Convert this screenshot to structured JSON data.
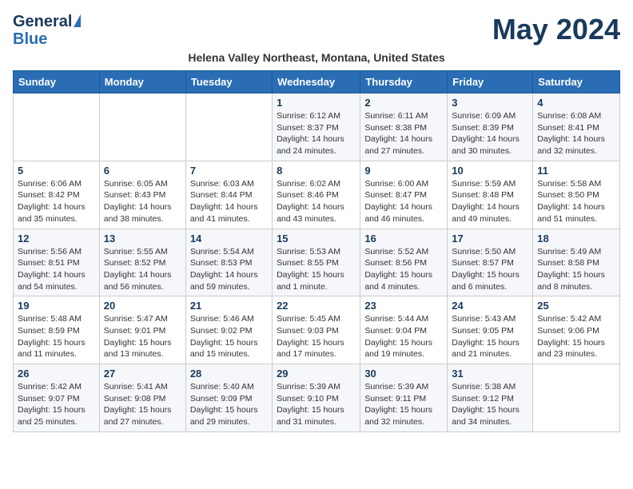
{
  "header": {
    "logo_line1": "General",
    "logo_line2": "Blue",
    "month_title": "May 2024",
    "subtitle": "Helena Valley Northeast, Montana, United States"
  },
  "days_of_week": [
    "Sunday",
    "Monday",
    "Tuesday",
    "Wednesday",
    "Thursday",
    "Friday",
    "Saturday"
  ],
  "weeks": [
    [
      {
        "day": "",
        "info": ""
      },
      {
        "day": "",
        "info": ""
      },
      {
        "day": "",
        "info": ""
      },
      {
        "day": "1",
        "info": "Sunrise: 6:12 AM\nSunset: 8:37 PM\nDaylight: 14 hours and 24 minutes."
      },
      {
        "day": "2",
        "info": "Sunrise: 6:11 AM\nSunset: 8:38 PM\nDaylight: 14 hours and 27 minutes."
      },
      {
        "day": "3",
        "info": "Sunrise: 6:09 AM\nSunset: 8:39 PM\nDaylight: 14 hours and 30 minutes."
      },
      {
        "day": "4",
        "info": "Sunrise: 6:08 AM\nSunset: 8:41 PM\nDaylight: 14 hours and 32 minutes."
      }
    ],
    [
      {
        "day": "5",
        "info": "Sunrise: 6:06 AM\nSunset: 8:42 PM\nDaylight: 14 hours and 35 minutes."
      },
      {
        "day": "6",
        "info": "Sunrise: 6:05 AM\nSunset: 8:43 PM\nDaylight: 14 hours and 38 minutes."
      },
      {
        "day": "7",
        "info": "Sunrise: 6:03 AM\nSunset: 8:44 PM\nDaylight: 14 hours and 41 minutes."
      },
      {
        "day": "8",
        "info": "Sunrise: 6:02 AM\nSunset: 8:46 PM\nDaylight: 14 hours and 43 minutes."
      },
      {
        "day": "9",
        "info": "Sunrise: 6:00 AM\nSunset: 8:47 PM\nDaylight: 14 hours and 46 minutes."
      },
      {
        "day": "10",
        "info": "Sunrise: 5:59 AM\nSunset: 8:48 PM\nDaylight: 14 hours and 49 minutes."
      },
      {
        "day": "11",
        "info": "Sunrise: 5:58 AM\nSunset: 8:50 PM\nDaylight: 14 hours and 51 minutes."
      }
    ],
    [
      {
        "day": "12",
        "info": "Sunrise: 5:56 AM\nSunset: 8:51 PM\nDaylight: 14 hours and 54 minutes."
      },
      {
        "day": "13",
        "info": "Sunrise: 5:55 AM\nSunset: 8:52 PM\nDaylight: 14 hours and 56 minutes."
      },
      {
        "day": "14",
        "info": "Sunrise: 5:54 AM\nSunset: 8:53 PM\nDaylight: 14 hours and 59 minutes."
      },
      {
        "day": "15",
        "info": "Sunrise: 5:53 AM\nSunset: 8:55 PM\nDaylight: 15 hours and 1 minute."
      },
      {
        "day": "16",
        "info": "Sunrise: 5:52 AM\nSunset: 8:56 PM\nDaylight: 15 hours and 4 minutes."
      },
      {
        "day": "17",
        "info": "Sunrise: 5:50 AM\nSunset: 8:57 PM\nDaylight: 15 hours and 6 minutes."
      },
      {
        "day": "18",
        "info": "Sunrise: 5:49 AM\nSunset: 8:58 PM\nDaylight: 15 hours and 8 minutes."
      }
    ],
    [
      {
        "day": "19",
        "info": "Sunrise: 5:48 AM\nSunset: 8:59 PM\nDaylight: 15 hours and 11 minutes."
      },
      {
        "day": "20",
        "info": "Sunrise: 5:47 AM\nSunset: 9:01 PM\nDaylight: 15 hours and 13 minutes."
      },
      {
        "day": "21",
        "info": "Sunrise: 5:46 AM\nSunset: 9:02 PM\nDaylight: 15 hours and 15 minutes."
      },
      {
        "day": "22",
        "info": "Sunrise: 5:45 AM\nSunset: 9:03 PM\nDaylight: 15 hours and 17 minutes."
      },
      {
        "day": "23",
        "info": "Sunrise: 5:44 AM\nSunset: 9:04 PM\nDaylight: 15 hours and 19 minutes."
      },
      {
        "day": "24",
        "info": "Sunrise: 5:43 AM\nSunset: 9:05 PM\nDaylight: 15 hours and 21 minutes."
      },
      {
        "day": "25",
        "info": "Sunrise: 5:42 AM\nSunset: 9:06 PM\nDaylight: 15 hours and 23 minutes."
      }
    ],
    [
      {
        "day": "26",
        "info": "Sunrise: 5:42 AM\nSunset: 9:07 PM\nDaylight: 15 hours and 25 minutes."
      },
      {
        "day": "27",
        "info": "Sunrise: 5:41 AM\nSunset: 9:08 PM\nDaylight: 15 hours and 27 minutes."
      },
      {
        "day": "28",
        "info": "Sunrise: 5:40 AM\nSunset: 9:09 PM\nDaylight: 15 hours and 29 minutes."
      },
      {
        "day": "29",
        "info": "Sunrise: 5:39 AM\nSunset: 9:10 PM\nDaylight: 15 hours and 31 minutes."
      },
      {
        "day": "30",
        "info": "Sunrise: 5:39 AM\nSunset: 9:11 PM\nDaylight: 15 hours and 32 minutes."
      },
      {
        "day": "31",
        "info": "Sunrise: 5:38 AM\nSunset: 9:12 PM\nDaylight: 15 hours and 34 minutes."
      },
      {
        "day": "",
        "info": ""
      }
    ]
  ]
}
